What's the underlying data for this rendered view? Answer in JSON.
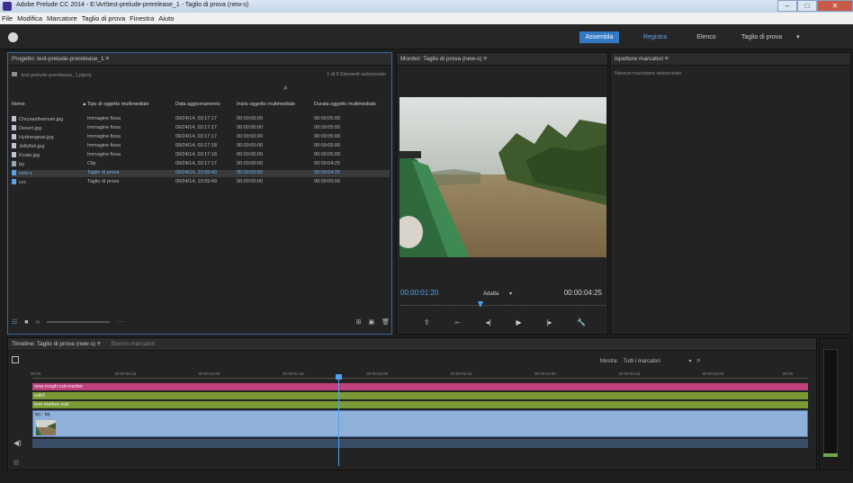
{
  "window": {
    "title": "Adobe Prelude CC 2014 - E:\\Art\\test-prelude-prerelease_1 - Taglio di prova (new-s)",
    "controls": [
      "–",
      "□",
      "✕"
    ]
  },
  "menu": [
    "File",
    "Modifica",
    "Marcatore",
    "Taglio di prova",
    "Finestra",
    "Aiuto"
  ],
  "workspaces": {
    "assemble": "Assembla",
    "record": "Registra",
    "list": "Elenco",
    "rough": "Taglio di prova",
    "rough_arrow": "▾"
  },
  "project": {
    "tab": "Progetto: test-prelude-prerelease_1  ≡",
    "path": "test-prelude-prerelease_1.plproj",
    "count": "1 di 8 Elementi selezionato",
    "columns": [
      "Nome",
      "Tipo di oggetto multimediale",
      "Data aggiornamento",
      "Inizio oggetto multimediale",
      "Durata oggetto multimediale"
    ],
    "rows": [
      {
        "name": "Chrysanthemum.jpg",
        "type": "Immagine fissa",
        "date": "09/24/14, 03:17:17",
        "start": "00:00:00:00",
        "dur": "00:00:05:00"
      },
      {
        "name": "Desert.jpg",
        "type": "Immagine fissa",
        "date": "09/24/14, 03:17:17",
        "start": "00:00:00:00",
        "dur": "00:00:05:00"
      },
      {
        "name": "Hydrangeas.jpg",
        "type": "Immagine fissa",
        "date": "09/24/14, 03:17:17",
        "start": "00:00:00:00",
        "dur": "00:00:05:00"
      },
      {
        "name": "Jellyfish.jpg",
        "type": "Immagine fissa",
        "date": "09/24/14, 03:17:18",
        "start": "00:00:00:00",
        "dur": "00:00:05:00"
      },
      {
        "name": "Koala.jpg",
        "type": "Immagine fissa",
        "date": "09/24/14, 03:17:18",
        "start": "00:00:00:00",
        "dur": "00:00:05:00"
      },
      {
        "name": "tpj",
        "type": "Clip",
        "date": "09/24/14, 03:17:17",
        "start": "00:00:00:00",
        "dur": "00:00:04:25"
      },
      {
        "name": "new-s",
        "type": "Taglio di prova",
        "date": "09/24/14, 13:09:40",
        "start": "00:00:00:00",
        "dur": "00:00:04:25"
      },
      {
        "name": "ccc",
        "type": "Taglio di prova",
        "date": "09/24/14, 13:09:49",
        "start": "00:00:00:00",
        "dur": "00:00:00:00"
      }
    ]
  },
  "monitor": {
    "tab": "Monitor: Taglio di prova (new-s)  ≡",
    "timecode_current": "00:00:01:20",
    "timecode_total": "00:00:04:25",
    "fit": "Adatta"
  },
  "inspector": {
    "tab": "Ispettore marcatori  ≡",
    "empty": "Nessun marcatore selezionato"
  },
  "timeline": {
    "tab": "Timeline: Taglio di prova (new-s)  ≡",
    "tab2": "Elenco marcatori",
    "show_label": "Mostra:",
    "show_value": "Tutti i marcatori",
    "ruler": [
      "00:00",
      "00:00:00:15",
      "00:00:01:00",
      "00:00:01:15",
      "00:00:02:00",
      "00:00:02:15",
      "00:00:03:00",
      "00:00:03:15",
      "00:00:04:00",
      "00:00"
    ],
    "tracks": [
      {
        "label": "new-rough-cut-marker",
        "color": "#c0407c"
      },
      {
        "label": "sub2",
        "color": "#7a9a35"
      },
      {
        "label": "test-marker-sub",
        "color": "#7a9a35"
      }
    ],
    "clip_label": "tpj - tpj",
    "playhead_fraction": 0.395
  }
}
